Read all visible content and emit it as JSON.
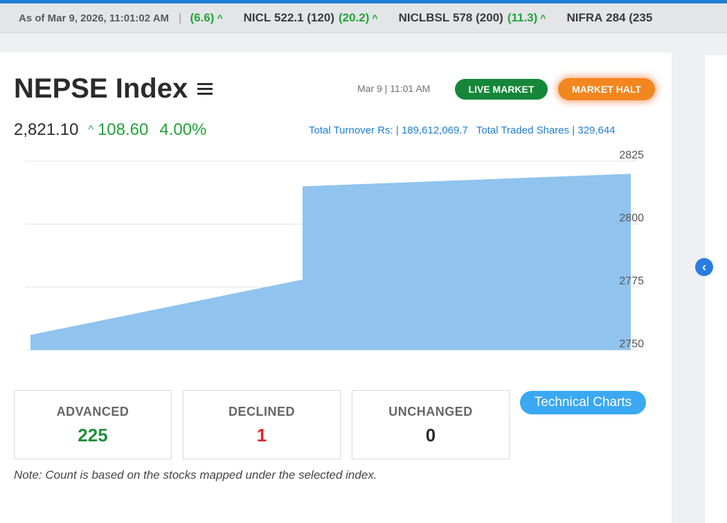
{
  "ticker": {
    "as_of": "As of Mar 9, 2026, 11:01:02 AM",
    "separator": "|",
    "partial_change": "(6.6)",
    "items": [
      {
        "symbol": "NICL",
        "price": "522.1",
        "qty": "(120)",
        "change": "(20.2)"
      },
      {
        "symbol": "NICLBSL",
        "price": "578",
        "qty": "(200)",
        "change": "(11.3)"
      },
      {
        "symbol": "NIFRA",
        "price": "284",
        "qty": "(235"
      }
    ]
  },
  "header": {
    "title": "NEPSE Index",
    "timestamp": "Mar 9 | 11:01 AM",
    "live_market_label": "LIVE MARKET",
    "market_halt_label": "MARKET HALT"
  },
  "index": {
    "value": "2,821.10",
    "change": "108.60",
    "percent": "4.00%"
  },
  "turnover": {
    "turnover_text": "Total Turnover Rs: | 189,612,069.7",
    "shares_text": "Total Traded Shares | 329,644"
  },
  "chart_data": {
    "type": "area",
    "x": [
      0,
      1,
      2
    ],
    "y": [
      2756,
      2778,
      2820
    ],
    "step_at": 1,
    "step_to": 2815,
    "ylim": [
      2750,
      2825
    ],
    "yticks": [
      "2825",
      "2800",
      "2775",
      "2750"
    ],
    "grid": true,
    "color": "#90c3ee"
  },
  "stats": {
    "advanced_label": "ADVANCED",
    "advanced_value": "225",
    "declined_label": "DECLINED",
    "declined_value": "1",
    "unchanged_label": "UNCHANGED",
    "unchanged_value": "0"
  },
  "technical_charts_label": "Technical Charts",
  "note": "Note: Count is based on the stocks mapped under the selected index.",
  "colors": {
    "accent": "#1e7fd6",
    "up": "#22a33a",
    "down": "#e0222b",
    "live": "#16873a",
    "halt": "#f2861f"
  }
}
